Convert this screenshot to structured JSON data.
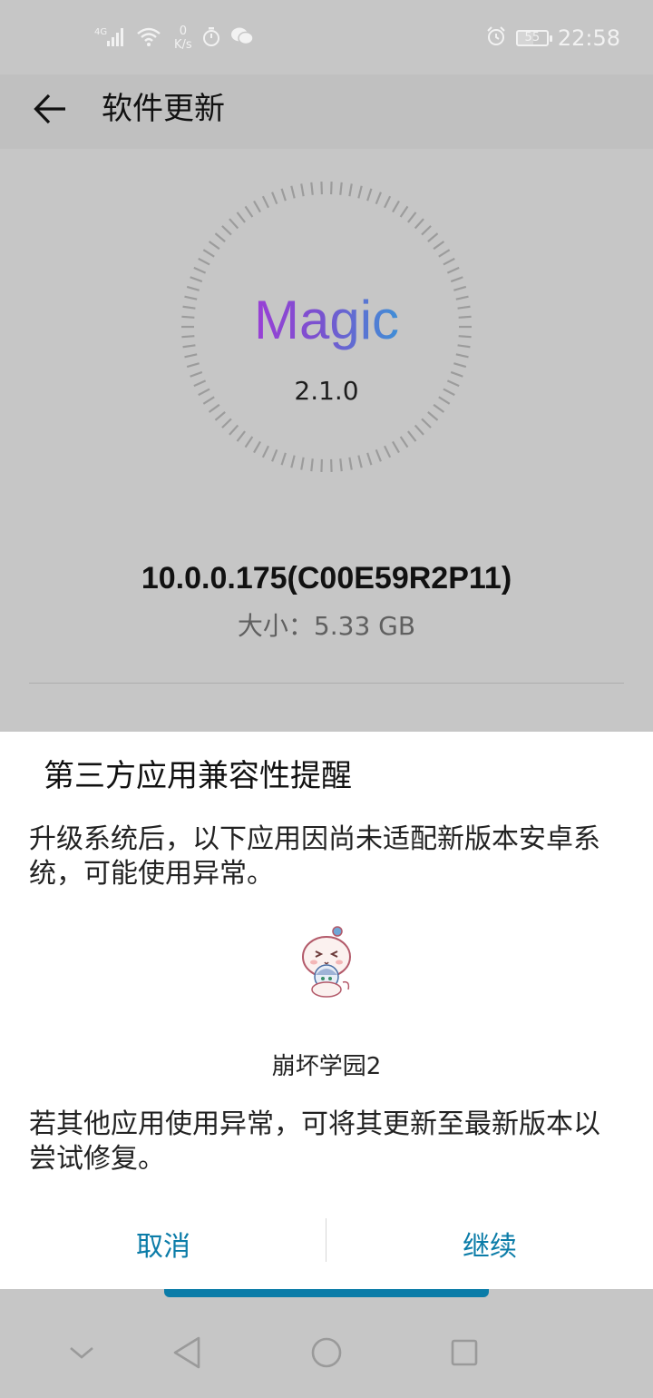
{
  "status_bar": {
    "network": "4G",
    "net_speed_value": "0",
    "net_speed_unit": "K/s",
    "battery_level": "55",
    "time": "22:58"
  },
  "header": {
    "title": "软件更新"
  },
  "dial": {
    "brand": "Magic",
    "brand_version": "2.1.0"
  },
  "update": {
    "version": "10.0.0.175(C00E59R2P11)",
    "size": "大小：5.33 GB"
  },
  "dialog": {
    "title": "第三方应用兼容性提醒",
    "message": "升级系统后，以下应用因尚未适配新版本安卓系统，可能使用异常。",
    "apps": [
      {
        "name": "崩坏学园2",
        "icon": "honkai-gakuen-2-app-icon"
      }
    ],
    "note": "若其他应用使用异常，可将其更新至最新版本以尝试修复。",
    "cancel_label": "取消",
    "continue_label": "继续"
  },
  "colors": {
    "accent": "#0b7ca8",
    "scrim": "#c6c6c6",
    "magic_gradient_start": "#9a3fd6",
    "magic_gradient_end": "#3f8fd6"
  },
  "nav": {
    "icons": [
      "chevron-down-icon",
      "back-triangle-icon",
      "home-circle-icon",
      "recents-square-icon"
    ]
  }
}
